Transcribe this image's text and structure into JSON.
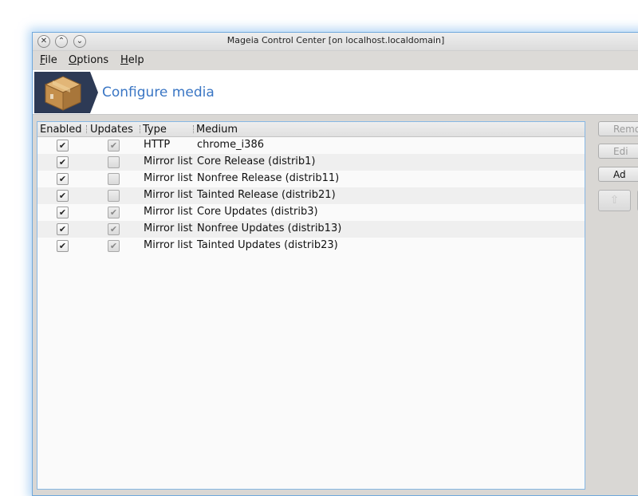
{
  "window": {
    "title": "Mageia Control Center  [on localhost.localdomain]",
    "title_buttons": [
      "close-icon",
      "minimize-icon",
      "maximize-icon"
    ]
  },
  "menubar": {
    "file": "File",
    "options": "Options",
    "help": "Help"
  },
  "header": {
    "title": "Configure media",
    "icon": "package-box-icon",
    "banner_color": "#2d3a55",
    "title_color": "#3a76c4"
  },
  "table": {
    "columns": {
      "enabled": "Enabled",
      "updates": "Updates",
      "type": "Type",
      "medium": "Medium"
    },
    "rows": [
      {
        "enabled": true,
        "updates": true,
        "type": "HTTP",
        "medium": "chrome_i386"
      },
      {
        "enabled": true,
        "updates": false,
        "type": "Mirror list",
        "medium": "Core Release (distrib1)"
      },
      {
        "enabled": true,
        "updates": false,
        "type": "Mirror list",
        "medium": "Nonfree Release (distrib11)"
      },
      {
        "enabled": true,
        "updates": false,
        "type": "Mirror list",
        "medium": "Tainted Release (distrib21)"
      },
      {
        "enabled": true,
        "updates": true,
        "type": "Mirror list",
        "medium": "Core Updates (distrib3)"
      },
      {
        "enabled": true,
        "updates": true,
        "type": "Mirror list",
        "medium": "Nonfree Updates (distrib13)"
      },
      {
        "enabled": true,
        "updates": true,
        "type": "Mirror list",
        "medium": "Tainted Updates (distrib23)"
      }
    ]
  },
  "side_buttons": {
    "remove": "Remo",
    "edit": "Edi",
    "add": "Ad"
  }
}
